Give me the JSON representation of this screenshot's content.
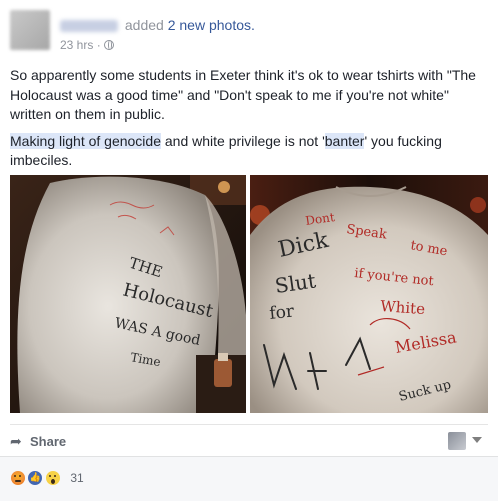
{
  "post": {
    "author_action": "added",
    "author_link": "2 new photos.",
    "timestamp": "23 hrs",
    "separator": "·",
    "privacy_icon": "globe-icon",
    "paragraph_1": "So apparently some students in Exeter think it's ok to wear tshirts with \"The Holocaust was a good time\" and \"Don't speak to me if you're not white\" written on them in public.",
    "paragraph_2_link_1": "Making light of genocide",
    "paragraph_2_mid": " and white privilege is not '",
    "paragraph_2_link_2": "banter",
    "paragraph_2_end": "' you fucking imbeciles."
  },
  "photos": [
    {
      "name": "photo-holocaust-shirt",
      "handwriting": [
        "THE",
        "Holocaust",
        "WAS A good",
        "Time"
      ]
    },
    {
      "name": "photo-dont-speak-shirt",
      "handwriting": [
        "Dont",
        "Speak",
        "to me",
        "Dick",
        "if you're not",
        "White",
        "Melissa",
        "Slut",
        "for",
        "Suck up"
      ]
    }
  ],
  "actions": {
    "share_label": "Share",
    "share_icon": "share-arrow-icon",
    "viewer_icon": "viewer-avatar-icon",
    "dropdown_icon": "chevron-down-icon"
  },
  "reactions": {
    "icons": [
      "angry-icon",
      "like-icon",
      "wow-icon"
    ],
    "count": "31"
  },
  "colors": {
    "link": "#365899",
    "secondary_text": "#90949c",
    "highlight": "#dce6f8",
    "marker_red": "#c2312a",
    "marker_black": "#2a2a2a"
  }
}
